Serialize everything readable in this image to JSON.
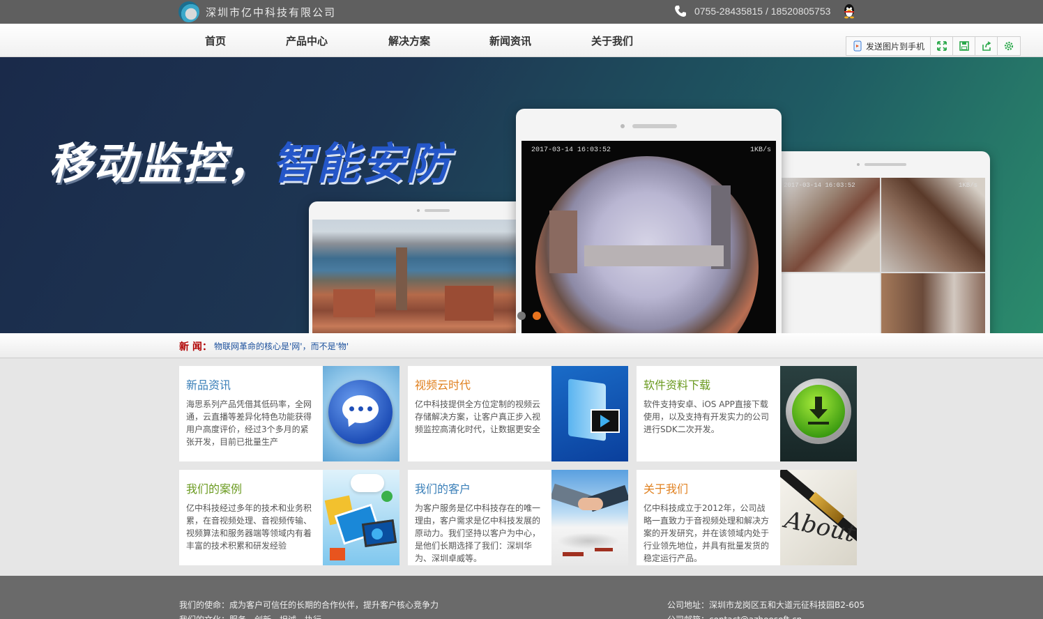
{
  "header": {
    "company_name": "深圳市亿中科技有限公司",
    "phone": "0755-28435815 / 18520805753"
  },
  "nav": {
    "items": [
      "首页",
      "产品中心",
      "解决方案",
      "新闻资讯",
      "关于我们"
    ]
  },
  "toolbar": {
    "send_label": "发送图片到手机"
  },
  "banner": {
    "title_white": "移动监控，",
    "title_blue": "智能安防",
    "timestamp_main": "2017-03-14 16:03:52",
    "rate_main": "1KB/s",
    "timestamp_right": "2017-03-14 16:03:52",
    "rate_right": "1KB/s",
    "slide_active": 2,
    "slide_count": 2
  },
  "ticker": {
    "label": "新 闻：",
    "text": "物联网革命的核心是'网'，而不是'物'"
  },
  "cards": [
    {
      "title": "新品资讯",
      "color": "#3a7fb8",
      "desc": "海思系列产品凭借其低码率，全网通，云直播等差异化特色功能获得用户高度评价，经过3个多月的紧张开发，目前已批量生产",
      "icon": "chat-bubble-icon"
    },
    {
      "title": "视频云时代",
      "color": "#e0801f",
      "desc": "亿中科技提供全方位定制的视频云存储解决方案，让客户真正步入视频监控高清化时代，让数据更安全",
      "icon": "video-cloud-icon"
    },
    {
      "title": "软件资料下载",
      "color": "#6a9a1f",
      "desc": "软件支持安卓、iOS APP直接下载使用，以及支持有开发实力的公司进行SDK二次开发。",
      "icon": "download-icon"
    },
    {
      "title": "我们的案例",
      "color": "#6a9a1f",
      "desc": "亿中科技经过多年的技术和业务积累，在音视频处理、音视频传输、视频算法和服务器端等领域内有着丰富的技术积累和研发经验",
      "icon": "cloud-devices-icon"
    },
    {
      "title": "我们的客户",
      "color": "#3a7fb8",
      "desc": "为客户服务是亿中科技存在的唯一理由，客户需求是亿中科技发展的原动力。我们坚持以客户为中心，是他们长期选择了我们：深圳华为、深圳卓威等。",
      "icon": "handshake-icon"
    },
    {
      "title": "关于我们",
      "color": "#e0801f",
      "desc": "亿中科技成立于2012年，公司战略一直致力于音视频处理和解决方案的开发研究，并在该领域内处于行业领先地位，并具有批量发货的稳定运行产品。",
      "icon": "pen-about-icon"
    }
  ],
  "footer": {
    "mission": "我们的使命：成为客户可信任的长期的合作伙伴，提升客户核心竞争力",
    "culture": "我们的文化：服务、创新、坦诚、执行",
    "address": "公司地址：深圳市龙岗区五和大道元征科技园B2-605",
    "email": "公司邮箱：contact@azhoosoft.cn"
  }
}
